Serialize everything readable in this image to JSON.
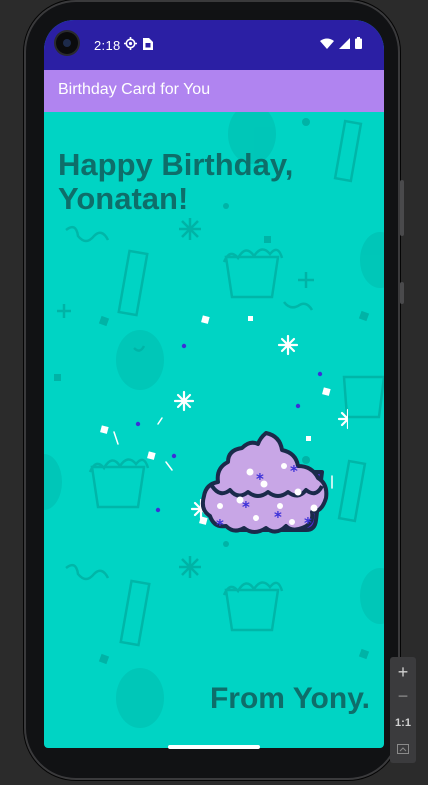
{
  "status_bar": {
    "time": "2:18",
    "left_icons": [
      "settings-icon",
      "sim-card-icon"
    ],
    "right_icons": [
      "wifi-icon",
      "signal-icon",
      "battery-icon"
    ],
    "color": "#2b1fa4"
  },
  "app_bar": {
    "title": "Birthday Card for You",
    "color": "#b084f0"
  },
  "card": {
    "greeting": "Happy Birthday, Yonatan!",
    "signature": "From Yony.",
    "background_color": "#00d4c4",
    "text_color": "#0e6e6a",
    "image": "cupcake-illustration"
  },
  "emulator_zoom": {
    "zoom_in": "+",
    "zoom_out": "−",
    "actual_size": "1:1",
    "fit_icon": "fit-screen-icon"
  }
}
